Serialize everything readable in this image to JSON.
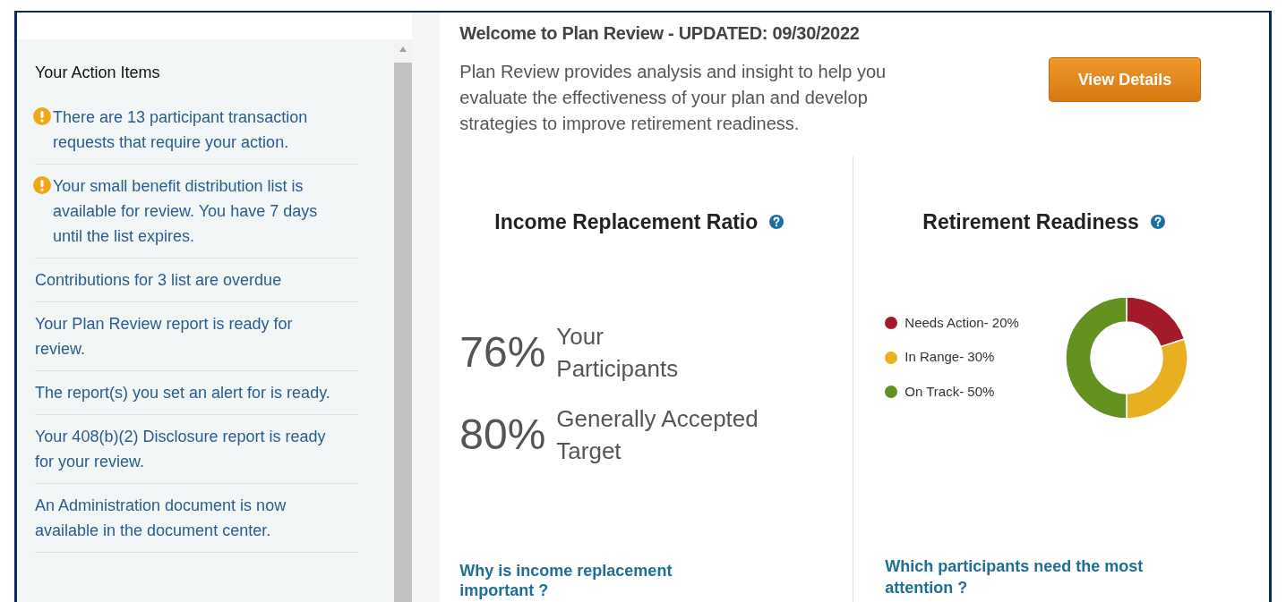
{
  "action_items": {
    "title": "Your Action Items",
    "items": [
      {
        "text": "There are 13 participant transaction requests that require your action.",
        "alert": true
      },
      {
        "text": "Your small benefit distribution list is available for review. You have 7 days until the list expires.",
        "alert": true
      },
      {
        "text": "Contributions for 3 list are overdue",
        "alert": false
      },
      {
        "text": "Your Plan Review report is ready for review.",
        "alert": false
      },
      {
        "text": "The report(s) you set an alert for is ready.",
        "alert": false
      },
      {
        "text": "Your 408(b)(2) Disclosure report is ready for your review.",
        "alert": false
      },
      {
        "text": "An Administration document is now available in the document center.",
        "alert": false
      }
    ]
  },
  "plan_review": {
    "heading": "Welcome to Plan Review - UPDATED: 09/30/2022",
    "description": "Plan Review provides analysis and insight to help you evaluate the effectiveness of your plan and develop strategies to improve retirement readiness.",
    "button": "View Details",
    "income": {
      "title": "Income Replacement Ratio",
      "stats": [
        {
          "value": "76%",
          "label": "Your Participants"
        },
        {
          "value": "80%",
          "label": "Generally Accepted Target"
        }
      ],
      "link": "Why is income replacement important ?"
    },
    "readiness": {
      "title": "Retirement Readiness",
      "legend": [
        {
          "label": "Needs Action- 20%",
          "color": "#a31b2a"
        },
        {
          "label": "In Range- 30%",
          "color": "#e8b020"
        },
        {
          "label": "On Track- 50%",
          "color": "#63901e"
        }
      ],
      "chart_data": {
        "type": "donut",
        "values": [
          20,
          30,
          50
        ]
      },
      "link": "Which participants need the most attention ?"
    }
  }
}
